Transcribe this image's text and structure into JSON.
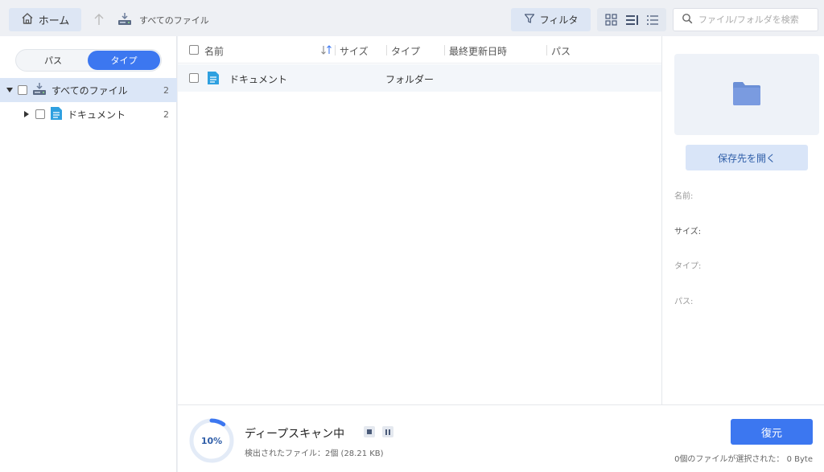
{
  "topbar": {
    "home_label": "ホーム",
    "breadcrumb_label": "すべてのファイル",
    "filter_label": "フィルタ",
    "search_placeholder": "ファイル/フォルダを検索"
  },
  "sidebar": {
    "segment": {
      "path_label": "パス",
      "type_label": "タイプ",
      "active": "タイプ"
    },
    "tree": [
      {
        "label": "すべてのファイル",
        "count": "2",
        "expanded": true,
        "selected": true
      },
      {
        "label": "ドキュメント",
        "count": "2",
        "expanded": false,
        "selected": false
      }
    ]
  },
  "list": {
    "headers": {
      "name": "名前",
      "size": "サイズ",
      "type": "タイプ",
      "modified": "最終更新日時",
      "path": "パス"
    },
    "rows": [
      {
        "name": "ドキュメント",
        "size": "",
        "type": "フォルダー",
        "modified": "",
        "path": ""
      }
    ]
  },
  "details": {
    "open_button": "保存先を開く",
    "name_label": "名前:",
    "size_label": "サイズ:",
    "type_label": "タイプ:",
    "path_label": "パス:"
  },
  "bottom": {
    "progress_text": "10%",
    "progress_value": 0.1,
    "scan_title": "ディープスキャン中",
    "found_text": "検出されたファイル：2個 (28.21 KB)",
    "recover_label": "復元",
    "selection_status": "0個のファイルが選択された： 0 Byte"
  },
  "colors": {
    "accent": "#3c77f0",
    "selected_row": "#dbe6f7",
    "folder_icon": "#6b8fd6",
    "doc_icon": "#2fa0e0"
  }
}
